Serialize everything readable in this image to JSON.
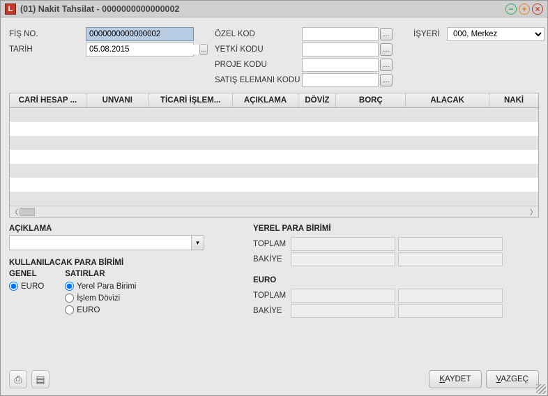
{
  "window": {
    "title": "(01) Nakit Tahsilat - 0000000000000002",
    "icon_letter": "L"
  },
  "header": {
    "fis_no": {
      "label": "FİŞ NO.",
      "value": "0000000000000002"
    },
    "tarih": {
      "label": "TARİH",
      "value": "05.08.2015"
    },
    "ozel_kod": {
      "label": "ÖZEL KOD",
      "value": ""
    },
    "yetki_kodu": {
      "label": "YETKİ KODU",
      "value": ""
    },
    "proje_kodu": {
      "label": "PROJE KODU",
      "value": ""
    },
    "satis_elemani": {
      "label": "SATIŞ ELEMANI KODU",
      "value": ""
    },
    "isyeri": {
      "label": "İŞYERİ",
      "value": "000, Merkez"
    }
  },
  "grid": {
    "columns": [
      "CARİ HESAP ...",
      "UNVANI",
      "TİCARİ İŞLEM...",
      "AÇIKLAMA",
      "DÖVİZ",
      "BORÇ",
      "ALACAK",
      "NAKİ"
    ]
  },
  "aciklama": {
    "label": "AÇIKLAMA",
    "value": ""
  },
  "currency": {
    "section": "KULLANILACAK PARA BİRİMİ",
    "genel": {
      "label": "GENEL",
      "options": [
        "EURO"
      ],
      "selected": "EURO"
    },
    "satirlar": {
      "label": "SATIRLAR",
      "options": [
        "Yerel Para Birimi",
        "İşlem Dövizi",
        "EURO"
      ],
      "selected": "Yerel Para Birimi"
    }
  },
  "totals": {
    "yerel": {
      "label": "YEREL PARA BİRİMİ",
      "toplam_label": "TOPLAM",
      "bakiye_label": "BAKİYE",
      "toplam1": "",
      "toplam2": "",
      "bakiye1": "",
      "bakiye2": ""
    },
    "euro": {
      "label": "EURO",
      "toplam_label": "TOPLAM",
      "bakiye_label": "BAKİYE",
      "toplam1": "",
      "toplam2": "",
      "bakiye1": "",
      "bakiye2": ""
    }
  },
  "footer": {
    "save": "KAYDET",
    "save_ul": "K",
    "cancel": "VAZGEÇ",
    "cancel_ul": "V"
  }
}
